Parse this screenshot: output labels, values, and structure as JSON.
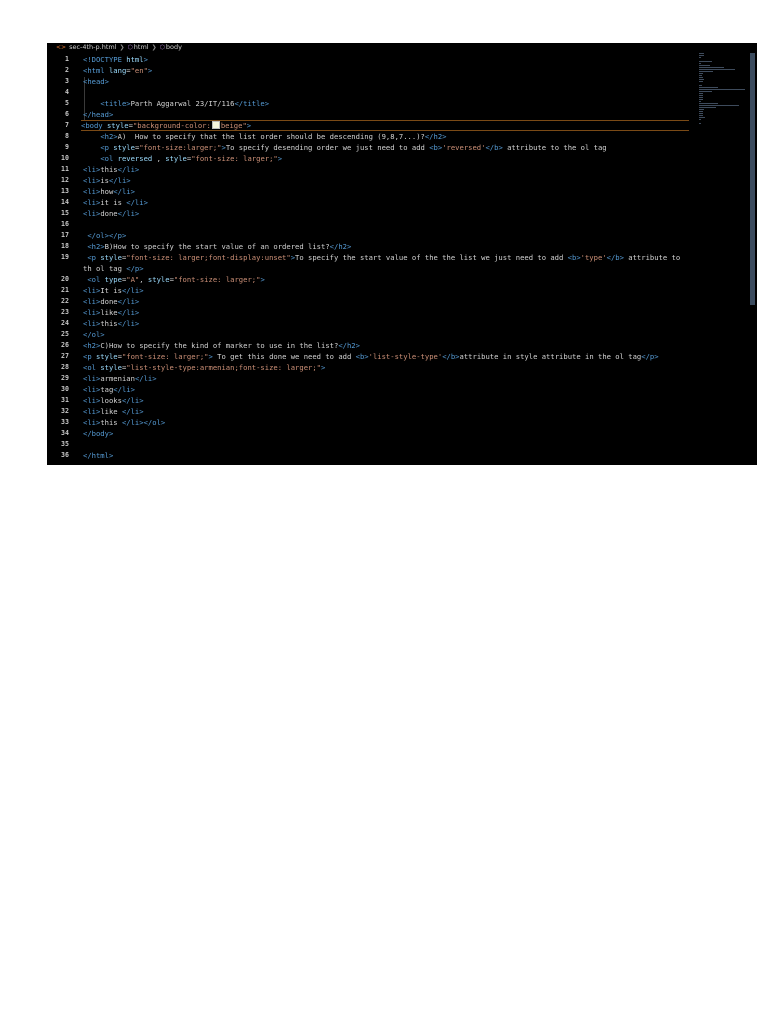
{
  "breadcrumb": {
    "file": "sec-4th-p.html",
    "crumb1": "html",
    "crumb2": "body"
  },
  "lines": [
    {
      "n": "1",
      "parts": [
        [
          "t",
          "<!DOCTYPE "
        ],
        [
          "a",
          "html"
        ],
        [
          "t",
          ">"
        ]
      ]
    },
    {
      "n": "2",
      "parts": [
        [
          "t",
          "<html "
        ],
        [
          "a",
          "lang"
        ],
        [
          "w",
          "="
        ],
        [
          "s",
          "\"en\""
        ],
        [
          "t",
          ">"
        ]
      ]
    },
    {
      "n": "3",
      "parts": [
        [
          "t",
          "<head>"
        ]
      ]
    },
    {
      "n": "4",
      "parts": []
    },
    {
      "n": "5",
      "parts": [
        [
          "w",
          "    "
        ],
        [
          "t",
          "<title>"
        ],
        [
          "w",
          "Parth Aggarwal 23/IT/116"
        ],
        [
          "t",
          "</title>"
        ]
      ]
    },
    {
      "n": "6",
      "parts": [
        [
          "t",
          "</head>"
        ]
      ]
    },
    {
      "n": "7",
      "parts": [
        [
          "t",
          "<body "
        ],
        [
          "a",
          "style"
        ],
        [
          "w",
          "="
        ],
        [
          "s",
          "\"background-color:"
        ],
        [
          "sw",
          ""
        ],
        [
          "s",
          "beige\""
        ],
        [
          "t",
          ">"
        ]
      ],
      "active": true
    },
    {
      "n": "8",
      "parts": [
        [
          "w",
          "    "
        ],
        [
          "t",
          "<h2>"
        ],
        [
          "w",
          "A)  How to specify that the list order should be descending (9,8,7...)?"
        ],
        [
          "t",
          "</h2>"
        ]
      ]
    },
    {
      "n": "9",
      "parts": [
        [
          "w",
          "    "
        ],
        [
          "t",
          "<p "
        ],
        [
          "a",
          "style"
        ],
        [
          "w",
          "="
        ],
        [
          "s",
          "\"font-size:larger;\""
        ],
        [
          "t",
          ">"
        ],
        [
          "w",
          "To specify desending order we just need to add "
        ],
        [
          "t",
          "<b>"
        ],
        [
          "s",
          "'reversed'"
        ],
        [
          "t",
          "</b>"
        ],
        [
          "w",
          " attribute to the ol tag"
        ]
      ]
    },
    {
      "n": "10",
      "parts": [
        [
          "w",
          "    "
        ],
        [
          "t",
          "<ol "
        ],
        [
          "a",
          "reversed"
        ],
        [
          "w",
          " , "
        ],
        [
          "a",
          "style"
        ],
        [
          "w",
          "="
        ],
        [
          "s",
          "\"font-size: larger;\""
        ],
        [
          "t",
          ">"
        ]
      ]
    },
    {
      "n": "11",
      "parts": [
        [
          "t",
          "<li>"
        ],
        [
          "w",
          "this"
        ],
        [
          "t",
          "</li>"
        ]
      ]
    },
    {
      "n": "12",
      "parts": [
        [
          "t",
          "<li>"
        ],
        [
          "w",
          "is"
        ],
        [
          "t",
          "</li>"
        ]
      ]
    },
    {
      "n": "13",
      "parts": [
        [
          "t",
          "<li>"
        ],
        [
          "w",
          "how"
        ],
        [
          "t",
          "</li>"
        ]
      ]
    },
    {
      "n": "14",
      "parts": [
        [
          "t",
          "<li>"
        ],
        [
          "w",
          "it is "
        ],
        [
          "t",
          "</li>"
        ]
      ]
    },
    {
      "n": "15",
      "parts": [
        [
          "t",
          "<li>"
        ],
        [
          "w",
          "done"
        ],
        [
          "t",
          "</li>"
        ]
      ]
    },
    {
      "n": "16",
      "parts": []
    },
    {
      "n": "17",
      "parts": [
        [
          "w",
          " "
        ],
        [
          "t",
          "</ol></p>"
        ]
      ]
    },
    {
      "n": "18",
      "parts": [
        [
          "w",
          " "
        ],
        [
          "t",
          "<h2>"
        ],
        [
          "w",
          "B)How to specify the start value of an ordered list?"
        ],
        [
          "t",
          "</h2>"
        ]
      ]
    },
    {
      "n": "19",
      "parts": [
        [
          "w",
          " "
        ],
        [
          "t",
          "<p "
        ],
        [
          "a",
          "style"
        ],
        [
          "w",
          "="
        ],
        [
          "s",
          "\"font-size: larger;font-display:unset\""
        ],
        [
          "t",
          ">"
        ],
        [
          "w",
          "To specify the start value of the the list we just need to add "
        ],
        [
          "t",
          "<b>"
        ],
        [
          "s",
          "'type'"
        ],
        [
          "t",
          "</b>"
        ],
        [
          "w",
          " attribute to th ol tag "
        ],
        [
          "t",
          "</p>"
        ]
      ],
      "tall": true
    },
    {
      "n": "20",
      "parts": [
        [
          "w",
          " "
        ],
        [
          "t",
          "<ol "
        ],
        [
          "a",
          "type"
        ],
        [
          "w",
          "="
        ],
        [
          "s",
          "\"A\""
        ],
        [
          "w",
          ", "
        ],
        [
          "a",
          "style"
        ],
        [
          "w",
          "="
        ],
        [
          "s",
          "\"font-size: larger;\""
        ],
        [
          "t",
          ">"
        ]
      ]
    },
    {
      "n": "21",
      "parts": [
        [
          "t",
          "<li>"
        ],
        [
          "w",
          "It is"
        ],
        [
          "t",
          "</li>"
        ]
      ]
    },
    {
      "n": "22",
      "parts": [
        [
          "t",
          "<li>"
        ],
        [
          "w",
          "done"
        ],
        [
          "t",
          "</li>"
        ]
      ]
    },
    {
      "n": "23",
      "parts": [
        [
          "t",
          "<li>"
        ],
        [
          "w",
          "like"
        ],
        [
          "t",
          "</li>"
        ]
      ]
    },
    {
      "n": "24",
      "parts": [
        [
          "t",
          "<li>"
        ],
        [
          "w",
          "this"
        ],
        [
          "t",
          "</li>"
        ]
      ]
    },
    {
      "n": "25",
      "parts": [
        [
          "t",
          "</ol>"
        ]
      ]
    },
    {
      "n": "26",
      "parts": [
        [
          "t",
          "<h2>"
        ],
        [
          "w",
          "C)How to specify the kind of marker to use in the list?"
        ],
        [
          "t",
          "</h2>"
        ]
      ]
    },
    {
      "n": "27",
      "parts": [
        [
          "t",
          "<p "
        ],
        [
          "a",
          "style"
        ],
        [
          "w",
          "="
        ],
        [
          "s",
          "\"font-size: larger;\""
        ],
        [
          "t",
          ">"
        ],
        [
          "w",
          " To get this done we need to add "
        ],
        [
          "t",
          "<b>"
        ],
        [
          "s",
          "'list-style-type'"
        ],
        [
          "t",
          "</b>"
        ],
        [
          "w",
          "attribute in style attribute in the ol tag"
        ],
        [
          "t",
          "</p>"
        ]
      ]
    },
    {
      "n": "28",
      "parts": [
        [
          "t",
          "<ol "
        ],
        [
          "a",
          "style"
        ],
        [
          "w",
          "="
        ],
        [
          "s",
          "\"list-style-type:armenian;font-size: larger;\""
        ],
        [
          "t",
          ">"
        ]
      ]
    },
    {
      "n": "29",
      "parts": [
        [
          "t",
          "<li>"
        ],
        [
          "w",
          "armenian"
        ],
        [
          "t",
          "</li>"
        ]
      ]
    },
    {
      "n": "30",
      "parts": [
        [
          "t",
          "<li>"
        ],
        [
          "w",
          "tag"
        ],
        [
          "t",
          "</li>"
        ]
      ]
    },
    {
      "n": "31",
      "parts": [
        [
          "t",
          "<li>"
        ],
        [
          "w",
          "looks"
        ],
        [
          "t",
          "</li>"
        ]
      ]
    },
    {
      "n": "32",
      "parts": [
        [
          "t",
          "<li>"
        ],
        [
          "w",
          "like "
        ],
        [
          "t",
          "</li>"
        ]
      ]
    },
    {
      "n": "33",
      "parts": [
        [
          "t",
          "<li>"
        ],
        [
          "w",
          "this "
        ],
        [
          "t",
          "</li></ol>"
        ]
      ]
    },
    {
      "n": "34",
      "parts": [
        [
          "t",
          "</body>"
        ]
      ]
    },
    {
      "n": "35",
      "parts": []
    },
    {
      "n": "36",
      "parts": [
        [
          "t",
          "</html>"
        ]
      ]
    }
  ],
  "colors": {
    "t": "#569cd6",
    "a": "#9cdcfe",
    "s": "#ce9178",
    "w": "#d4d4d4",
    "swatch": "#f5f5dc",
    "editor_bg": "#000000",
    "active_border": "#7a4a16"
  },
  "icons": {
    "file": "html-file-icon",
    "symbol": "element-symbol-icon",
    "separator": "chevron-right-icon"
  }
}
